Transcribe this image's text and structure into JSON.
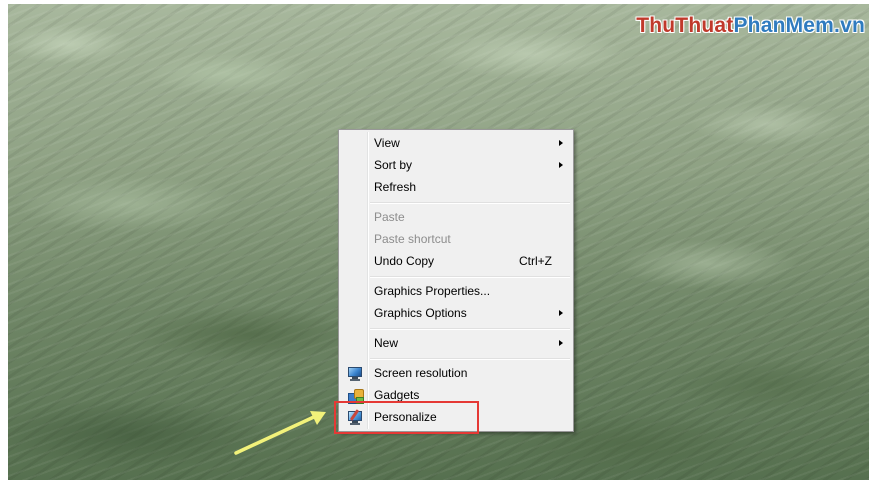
{
  "watermark": {
    "part1": "ThuThuat",
    "part2": "PhanMem.vn"
  },
  "context_menu": {
    "view": "View",
    "sort_by": "Sort by",
    "refresh": "Refresh",
    "paste": "Paste",
    "paste_shortcut": "Paste shortcut",
    "undo_copy": "Undo Copy",
    "undo_copy_shortcut": "Ctrl+Z",
    "graphics_properties": "Graphics Properties...",
    "graphics_options": "Graphics Options",
    "new": "New",
    "screen_resolution": "Screen resolution",
    "gadgets": "Gadgets",
    "personalize": "Personalize"
  },
  "colors": {
    "highlight": "#e53935",
    "arrow": "#f2f27a",
    "watermark_red": "#c0392b",
    "watermark_blue": "#2f7bbf"
  },
  "icons": {
    "screen_resolution": "monitor-icon",
    "gadgets": "gadgets-icon",
    "personalize": "personalize-icon"
  }
}
